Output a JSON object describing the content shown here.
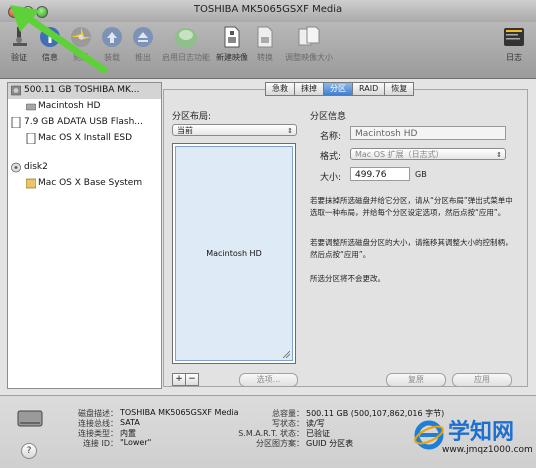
{
  "window": {
    "title": "TOSHIBA MK5065GSXF Media"
  },
  "toolbar": {
    "items": [
      {
        "id": "verify",
        "label": "验证"
      },
      {
        "id": "info",
        "label": "信息"
      },
      {
        "id": "burn",
        "label": "刻录"
      },
      {
        "id": "mount",
        "label": "装载"
      },
      {
        "id": "eject",
        "label": "推出"
      },
      {
        "id": "journal",
        "label": "启用日志功能"
      },
      {
        "id": "new-image",
        "label": "新建映像"
      },
      {
        "id": "convert",
        "label": "转换"
      },
      {
        "id": "resize-image",
        "label": "调整映像大小"
      },
      {
        "id": "log",
        "label": "日志"
      }
    ]
  },
  "sidebar": {
    "items": [
      {
        "label": "500.11 GB TOSHIBA MK...",
        "level": 0,
        "selected": true
      },
      {
        "label": "Macintosh HD",
        "level": 1
      },
      {
        "label": "7.9 GB ADATA USB Flash...",
        "level": 0
      },
      {
        "label": "Mac OS X Install ESD",
        "level": 1
      },
      {
        "label": "disk2",
        "level": 0
      },
      {
        "label": "Mac OS X Base System",
        "level": 1
      }
    ]
  },
  "tabs": [
    {
      "label": "急救"
    },
    {
      "label": "抹掉"
    },
    {
      "label": "分区",
      "active": true
    },
    {
      "label": "RAID"
    },
    {
      "label": "恢复"
    }
  ],
  "partition": {
    "layout_heading": "分区布局:",
    "layout_value": "当前",
    "partition_label": "Macintosh HD",
    "add_button": "+",
    "remove_button": "−",
    "options_button": "选项...",
    "info_heading": "分区信息",
    "name_label": "名称:",
    "name_value": "Macintosh HD",
    "format_label": "格式:",
    "format_value": "Mac OS 扩展（日志式）",
    "size_label": "大小:",
    "size_value": "499.76",
    "size_unit": "GB",
    "para1": "若要抹掉所选磁盘并给它分区，请从“分区布局”弹出式菜单中选取一种布局，并给每个分区设定选项，然后点按“应用”。",
    "para2": "若要调整所选磁盘分区的大小，请拖移其调整大小的控制柄，然后点按“应用”。",
    "para3": "所选分区将不会更改。",
    "revert_button": "复原",
    "apply_button": "应用"
  },
  "info": {
    "left": [
      {
        "key": "磁盘描述：",
        "value": "TOSHIBA MK5065GSXF Media"
      },
      {
        "key": "连接总线：",
        "value": "SATA"
      },
      {
        "key": "连接类型：",
        "value": "内置"
      },
      {
        "key": "连接 ID：",
        "value": "\"Lower\""
      }
    ],
    "right": [
      {
        "key": "总容量：",
        "value": "500.11 GB (500,107,862,016 字节)"
      },
      {
        "key": "写状态：",
        "value": "读/写"
      },
      {
        "key": "S.M.A.R.T. 状态：",
        "value": "已验证"
      },
      {
        "key": "分区图方案：",
        "value": "GUID 分区表"
      }
    ],
    "help": "?"
  },
  "watermark": {
    "text": "学知网",
    "url": "www.jmqz1000.com"
  }
}
